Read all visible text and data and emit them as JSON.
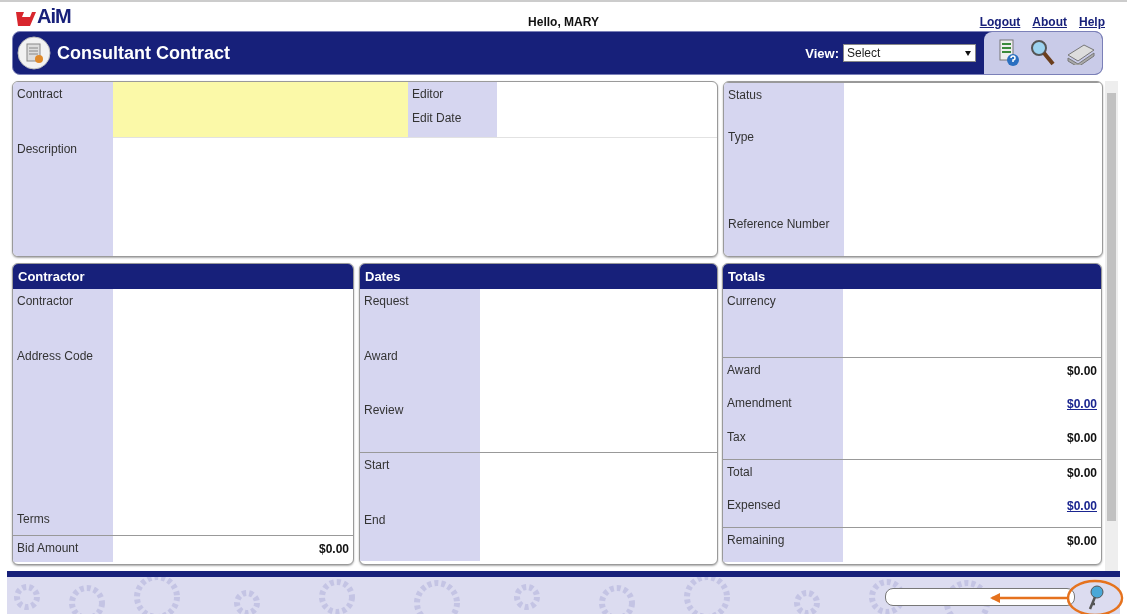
{
  "logo": "AiM",
  "greeting": "Hello, MARY",
  "top_links": [
    "Logout",
    "About",
    "Help"
  ],
  "header": {
    "title": "Consultant Contract",
    "view_label": "View:",
    "view_select": "Select"
  },
  "main_panel": {
    "contract_label": "Contract",
    "editor_label": "Editor",
    "edit_date_label": "Edit Date",
    "description_label": "Description"
  },
  "status_panel": {
    "fields": [
      "Status",
      "Type",
      "Reference Number"
    ]
  },
  "contractor": {
    "title": "Contractor",
    "rows": [
      {
        "label": "Contractor"
      },
      {
        "label": "Address Code"
      },
      {
        "label": "Terms"
      },
      {
        "label": "Bid Amount",
        "value": "$0.00",
        "kind": "plain"
      }
    ]
  },
  "dates": {
    "title": "Dates",
    "rows": [
      {
        "label": "Request"
      },
      {
        "label": "Award"
      },
      {
        "label": "Review"
      },
      {
        "label": "Start"
      },
      {
        "label": "End"
      }
    ]
  },
  "totals": {
    "title": "Totals",
    "rows": [
      {
        "label": "Currency"
      },
      {
        "label": "Award",
        "value": "$0.00",
        "kind": "plain"
      },
      {
        "label": "Amendment",
        "value": "$0.00",
        "kind": "link"
      },
      {
        "label": "Tax",
        "value": "$0.00",
        "kind": "plain"
      },
      {
        "label": "Total",
        "value": "$0.00",
        "kind": "plain"
      },
      {
        "label": "Expensed",
        "value": "$0.00",
        "kind": "link"
      },
      {
        "label": "Remaining",
        "value": "$0.00",
        "kind": "plain"
      }
    ]
  }
}
